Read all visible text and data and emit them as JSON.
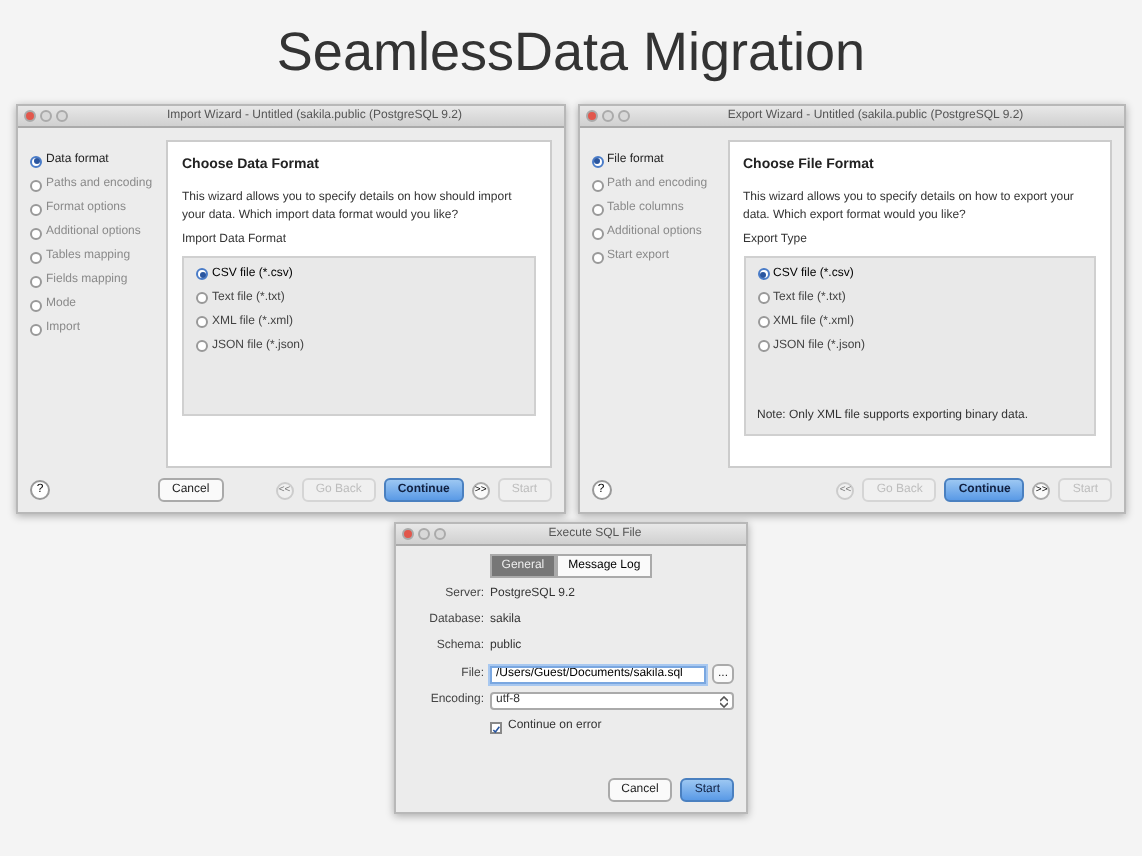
{
  "title": "SeamlessData Migration",
  "wizards": [
    {
      "title": "Import Wizard - Untitled (sakila.public (PostgreSQL 9.2)",
      "steps": [
        {
          "label": "Data format",
          "selected": true
        },
        {
          "label": "Paths and encoding",
          "selected": false
        },
        {
          "label": "Format options",
          "selected": false
        },
        {
          "label": "Additional options",
          "selected": false
        },
        {
          "label": "Tables mapping",
          "selected": false
        },
        {
          "label": "Fields mapping",
          "selected": false
        },
        {
          "label": "Mode",
          "selected": false
        },
        {
          "label": "Import",
          "selected": false
        }
      ],
      "heading": "Choose Data Format",
      "description": "This wizard allows you to specify details on how should import your data. Which import data format would you like?",
      "group_label": "Import Data Format",
      "options": [
        {
          "label": "CSV file (*.csv)",
          "selected": true
        },
        {
          "label": "Text file (*.txt)",
          "selected": false
        },
        {
          "label": "XML file (*.xml)",
          "selected": false
        },
        {
          "label": "JSON file (*.json)",
          "selected": false
        }
      ],
      "buttons": [
        {
          "kind": "help",
          "label": "?"
        },
        {
          "kind": "push",
          "label": "Cancel",
          "disabled": false,
          "default": false
        },
        {
          "kind": "spacer"
        },
        {
          "kind": "nav",
          "label": "<<",
          "disabled": true
        },
        {
          "kind": "push",
          "label": "Go Back",
          "disabled": true,
          "default": false
        },
        {
          "kind": "push",
          "label": "Continue",
          "disabled": false,
          "default": true
        },
        {
          "kind": "nav",
          "label": ">>",
          "disabled": false
        },
        {
          "kind": "push",
          "label": "Start",
          "disabled": true,
          "default": false
        }
      ]
    },
    {
      "title": "Export Wizard - Untitled (sakila.public (PostgreSQL 9.2)",
      "steps": [
        {
          "label": "File format",
          "selected": true
        },
        {
          "label": "Path and encoding",
          "selected": false
        },
        {
          "label": "Table columns",
          "selected": false
        },
        {
          "label": "Additional options",
          "selected": false
        },
        {
          "label": "Start export",
          "selected": false
        }
      ],
      "heading": "Choose File Format",
      "description": "This wizard allows you to specify details on how to export your data. Which export format would you like?",
      "group_label": "Export Type",
      "options": [
        {
          "label": "CSV file (*.csv)",
          "selected": true
        },
        {
          "label": "Text file (*.txt)",
          "selected": false
        },
        {
          "label": "XML file (*.xml)",
          "selected": false
        },
        {
          "label": "JSON file (*.json)",
          "selected": false
        }
      ],
      "note": "Note: Only XML file supports exporting binary data.",
      "buttons": [
        {
          "kind": "help",
          "label": "?"
        },
        {
          "kind": "spacer"
        },
        {
          "kind": "nav",
          "label": "<<",
          "disabled": true
        },
        {
          "kind": "push",
          "label": "Go Back",
          "disabled": true,
          "default": false
        },
        {
          "kind": "push",
          "label": "Continue",
          "disabled": false,
          "default": true
        },
        {
          "kind": "nav",
          "label": ">>",
          "disabled": false
        },
        {
          "kind": "push",
          "label": "Start",
          "disabled": true,
          "default": false
        }
      ]
    }
  ],
  "execute_dialog": {
    "title": "Execute SQL File",
    "tabs": [
      {
        "label": "General",
        "selected": true
      },
      {
        "label": "Message Log",
        "selected": false
      }
    ],
    "info": [
      {
        "label": "Server:",
        "value": "PostgreSQL 9.2"
      },
      {
        "label": "Database:",
        "value": "sakila"
      },
      {
        "label": "Schema:",
        "value": "public"
      }
    ],
    "file": {
      "label": "File:",
      "value": "/Users/Guest/Documents/sakila.sql",
      "browse": "..."
    },
    "encoding": {
      "label": "Encoding:",
      "value": "utf-8"
    },
    "continue_on_error": {
      "label": "Continue on error",
      "checked": true
    },
    "buttons": [
      {
        "label": "Cancel",
        "default": false
      },
      {
        "label": "Start",
        "default": true
      }
    ]
  }
}
